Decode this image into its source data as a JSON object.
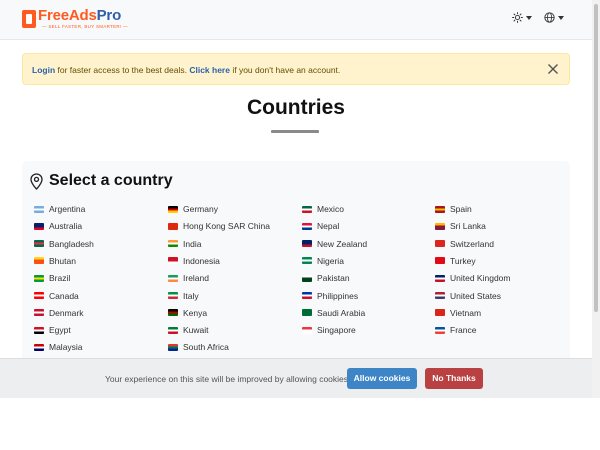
{
  "brand": {
    "name_part1": "FreeAds",
    "name_part2": "Pro",
    "tagline": "— SELL FASTER, BUY SMARTER! —"
  },
  "nav": {
    "theme_icon": "sun-icon",
    "language_icon": "globe-icon"
  },
  "alert": {
    "login_link": "Login",
    "login_text": " for faster access to the best deals. ",
    "register_link": "Click here",
    "register_text": " if you don't have an account."
  },
  "page": {
    "title": "Countries"
  },
  "card": {
    "heading": "Select a country",
    "heading_icon": "map-pin-icon"
  },
  "countries": {
    "col1": [
      {
        "name": "Argentina",
        "flag": [
          "#74acdf",
          "#ffffff",
          "#74acdf"
        ]
      },
      {
        "name": "Australia",
        "flag": [
          "#012169",
          "#012169",
          "#e4002b"
        ]
      },
      {
        "name": "Bangladesh",
        "flag": [
          "#006a4e",
          "#f42a41",
          "#006a4e"
        ]
      },
      {
        "name": "Bhutan",
        "flag": [
          "#ffd520",
          "#ff4e12",
          "#ff4e12"
        ]
      },
      {
        "name": "Brazil",
        "flag": [
          "#009c3b",
          "#ffdf00",
          "#009c3b"
        ]
      },
      {
        "name": "Canada",
        "flag": [
          "#ff0000",
          "#ffffff",
          "#ff0000"
        ]
      },
      {
        "name": "Denmark",
        "flag": [
          "#c8102e",
          "#ffffff",
          "#c8102e"
        ]
      },
      {
        "name": "Egypt",
        "flag": [
          "#ce1126",
          "#ffffff",
          "#000000"
        ]
      },
      {
        "name": "Malaysia",
        "flag": [
          "#cc0001",
          "#ffffff",
          "#010066"
        ]
      }
    ],
    "col2": [
      {
        "name": "Germany",
        "flag": [
          "#000000",
          "#dd0000",
          "#ffce00"
        ]
      },
      {
        "name": "Hong Kong SAR China",
        "flag": [
          "#de2910",
          "#de2910",
          "#de2910"
        ]
      },
      {
        "name": "India",
        "flag": [
          "#ff9933",
          "#ffffff",
          "#138808"
        ]
      },
      {
        "name": "Indonesia",
        "flag": [
          "#ce1126",
          "#ce1126",
          "#ffffff"
        ]
      },
      {
        "name": "Ireland",
        "flag": [
          "#169b62",
          "#ffffff",
          "#ff883e"
        ]
      },
      {
        "name": "Italy",
        "flag": [
          "#009246",
          "#ffffff",
          "#ce2b37"
        ]
      },
      {
        "name": "Kenya",
        "flag": [
          "#000000",
          "#bb0000",
          "#006600"
        ]
      },
      {
        "name": "Kuwait",
        "flag": [
          "#007a3d",
          "#ffffff",
          "#ce1126"
        ]
      },
      {
        "name": "South Africa",
        "flag": [
          "#de3831",
          "#007a4d",
          "#002395"
        ]
      }
    ],
    "col3": [
      {
        "name": "Mexico",
        "flag": [
          "#006847",
          "#ffffff",
          "#ce1126"
        ]
      },
      {
        "name": "Nepal",
        "flag": [
          "#dc143c",
          "#ffffff",
          "#003893"
        ]
      },
      {
        "name": "New Zealand",
        "flag": [
          "#012169",
          "#012169",
          "#c8102e"
        ]
      },
      {
        "name": "Nigeria",
        "flag": [
          "#008751",
          "#ffffff",
          "#008751"
        ]
      },
      {
        "name": "Pakistan",
        "flag": [
          "#ffffff",
          "#01411c",
          "#01411c"
        ]
      },
      {
        "name": "Philippines",
        "flag": [
          "#0038a8",
          "#ffffff",
          "#ce1126"
        ]
      },
      {
        "name": "Saudi Arabia",
        "flag": [
          "#006c35",
          "#006c35",
          "#006c35"
        ]
      },
      {
        "name": "Singapore",
        "flag": [
          "#ef3340",
          "#ffffff",
          "#ffffff"
        ]
      }
    ],
    "col4": [
      {
        "name": "Spain",
        "flag": [
          "#aa151b",
          "#f1bf00",
          "#aa151b"
        ]
      },
      {
        "name": "Sri Lanka",
        "flag": [
          "#ffb700",
          "#8d153a",
          "#8d153a"
        ]
      },
      {
        "name": "Switzerland",
        "flag": [
          "#da291c",
          "#da291c",
          "#da291c"
        ]
      },
      {
        "name": "Turkey",
        "flag": [
          "#e30a17",
          "#e30a17",
          "#e30a17"
        ]
      },
      {
        "name": "United Kingdom",
        "flag": [
          "#012169",
          "#ffffff",
          "#c8102e"
        ]
      },
      {
        "name": "United States",
        "flag": [
          "#b22234",
          "#ffffff",
          "#3c3b6e"
        ]
      },
      {
        "name": "Vietnam",
        "flag": [
          "#da251d",
          "#da251d",
          "#da251d"
        ]
      },
      {
        "name": "France",
        "flag": [
          "#0055a4",
          "#ffffff",
          "#ef4135"
        ]
      }
    ]
  },
  "cookie": {
    "message": "Your experience on this site will be improved by allowing cookies.",
    "allow_label": "Allow cookies",
    "deny_label": "No Thanks"
  }
}
